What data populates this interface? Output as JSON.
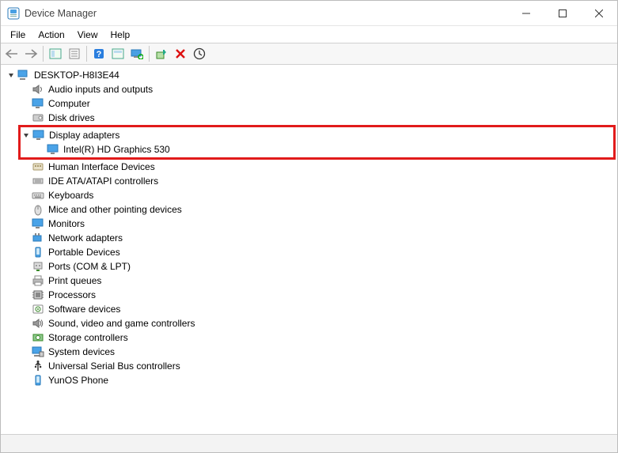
{
  "window": {
    "title": "Device Manager"
  },
  "menu": {
    "items": [
      "File",
      "Action",
      "View",
      "Help"
    ]
  },
  "tree": {
    "root": {
      "label": "DESKTOP-H8I3E44",
      "expanded": true,
      "children": [
        {
          "label": "Audio inputs and outputs",
          "icon": "speaker",
          "expanded": false
        },
        {
          "label": "Computer",
          "icon": "monitor",
          "expanded": false
        },
        {
          "label": "Disk drives",
          "icon": "disk",
          "expanded": false
        },
        {
          "label": "Display adapters",
          "icon": "monitor",
          "expanded": true,
          "highlighted": true,
          "children": [
            {
              "label": "Intel(R) HD Graphics 530",
              "icon": "monitor"
            }
          ]
        },
        {
          "label": "Human Interface Devices",
          "icon": "hid",
          "expanded": false
        },
        {
          "label": "IDE ATA/ATAPI controllers",
          "icon": "ide",
          "expanded": false
        },
        {
          "label": "Keyboards",
          "icon": "keyboard",
          "expanded": false
        },
        {
          "label": "Mice and other pointing devices",
          "icon": "mouse",
          "expanded": false
        },
        {
          "label": "Monitors",
          "icon": "monitor",
          "expanded": false
        },
        {
          "label": "Network adapters",
          "icon": "network",
          "expanded": false
        },
        {
          "label": "Portable Devices",
          "icon": "portable",
          "expanded": false
        },
        {
          "label": "Ports (COM & LPT)",
          "icon": "port",
          "expanded": false
        },
        {
          "label": "Print queues",
          "icon": "printer",
          "expanded": false
        },
        {
          "label": "Processors",
          "icon": "cpu",
          "expanded": false
        },
        {
          "label": "Software devices",
          "icon": "software",
          "expanded": false
        },
        {
          "label": "Sound, video and game controllers",
          "icon": "sound",
          "expanded": false
        },
        {
          "label": "Storage controllers",
          "icon": "storage",
          "expanded": false
        },
        {
          "label": "System devices",
          "icon": "system",
          "expanded": false
        },
        {
          "label": "Universal Serial Bus controllers",
          "icon": "usb",
          "expanded": false
        },
        {
          "label": "YunOS Phone",
          "icon": "portable",
          "expanded": false
        }
      ]
    }
  }
}
